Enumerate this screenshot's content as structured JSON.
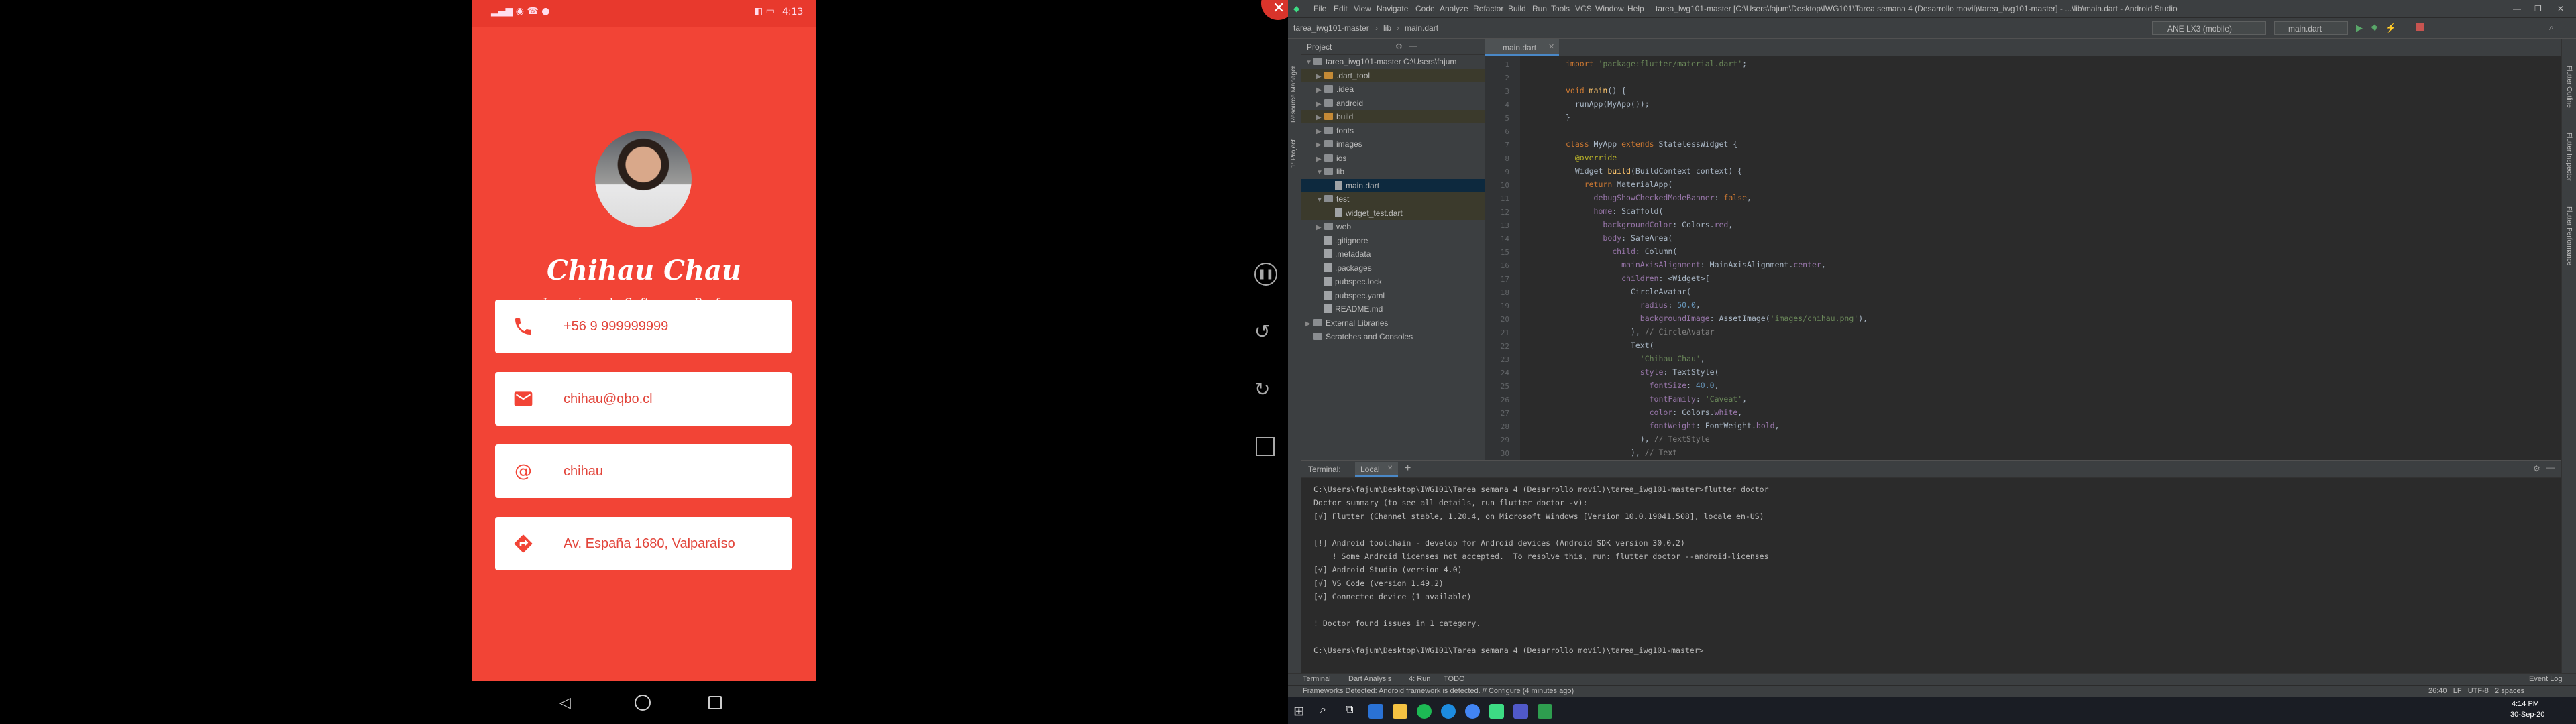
{
  "phone": {
    "status_time": "4:13",
    "name": "Chihau Chau",
    "subtitle": "Ingeniero de Software y Profesor",
    "cards": [
      {
        "icon": "phone-icon",
        "text": "+56 9 999999999"
      },
      {
        "icon": "mail-icon",
        "text": "chihau@qbo.cl"
      },
      {
        "icon": "at-icon",
        "text": "chihau"
      },
      {
        "icon": "directions-icon",
        "text": "Av. España 1680, Valparaíso"
      }
    ]
  },
  "ide": {
    "title": "tarea_lwg101-master [C:\\Users\\fajum\\Desktop\\IWG101\\Tarea semana 4 (Desarrollo movil)\\tarea_iwg101-master] - ...\\lib\\main.dart - Android Studio",
    "menu": [
      "File",
      "Edit",
      "View",
      "Navigate",
      "Code",
      "Analyze",
      "Refactor",
      "Build",
      "Run",
      "Tools",
      "VCS",
      "Window",
      "Help"
    ],
    "breadcrumb": [
      "tarea_iwg101-master",
      "lib",
      "main.dart"
    ],
    "device_select": "ANE LX3 (mobile)",
    "run_config": "main.dart",
    "project_label": "Project",
    "tree": [
      {
        "label": "tarea_iwg101-master  C:\\Users\\fajum",
        "indent": 0,
        "arrow": "▼",
        "kind": "folder"
      },
      {
        "label": ".dart_tool",
        "indent": 1,
        "arrow": "▶",
        "kind": "orange"
      },
      {
        "label": ".idea",
        "indent": 1,
        "arrow": "▶",
        "kind": "folder"
      },
      {
        "label": "android",
        "indent": 1,
        "arrow": "▶",
        "kind": "folder"
      },
      {
        "label": "build",
        "indent": 1,
        "arrow": "▶",
        "kind": "orange"
      },
      {
        "label": "fonts",
        "indent": 1,
        "arrow": "▶",
        "kind": "folder"
      },
      {
        "label": "images",
        "indent": 1,
        "arrow": "▶",
        "kind": "folder"
      },
      {
        "label": "ios",
        "indent": 1,
        "arrow": "▶",
        "kind": "folder"
      },
      {
        "label": "lib",
        "indent": 1,
        "arrow": "▼",
        "kind": "folder"
      },
      {
        "label": "main.dart",
        "indent": 2,
        "arrow": "",
        "kind": "file",
        "selected": true
      },
      {
        "label": "test",
        "indent": 1,
        "arrow": "▼",
        "kind": "folder"
      },
      {
        "label": "widget_test.dart",
        "indent": 2,
        "arrow": "",
        "kind": "file"
      },
      {
        "label": "web",
        "indent": 1,
        "arrow": "▶",
        "kind": "folder"
      },
      {
        "label": ".gitignore",
        "indent": 1,
        "arrow": "",
        "kind": "file"
      },
      {
        "label": ".metadata",
        "indent": 1,
        "arrow": "",
        "kind": "file"
      },
      {
        "label": ".packages",
        "indent": 1,
        "arrow": "",
        "kind": "file"
      },
      {
        "label": "pubspec.lock",
        "indent": 1,
        "arrow": "",
        "kind": "file"
      },
      {
        "label": "pubspec.yaml",
        "indent": 1,
        "arrow": "",
        "kind": "file"
      },
      {
        "label": "README.md",
        "indent": 1,
        "arrow": "",
        "kind": "file"
      },
      {
        "label": "External Libraries",
        "indent": 0,
        "arrow": "▶",
        "kind": "folder"
      },
      {
        "label": "Scratches and Consoles",
        "indent": 0,
        "arrow": "",
        "kind": "folder"
      }
    ],
    "editor_tab": "main.dart",
    "line_numbers": [
      "1",
      "2",
      "3",
      "4",
      "5",
      "6",
      "7",
      "8",
      "9",
      "10",
      "11",
      "12",
      "13",
      "14",
      "15",
      "16",
      "17",
      "18",
      "19",
      "20",
      "21",
      "22",
      "23",
      "24",
      "25",
      "26",
      "27",
      "28",
      "29",
      "30"
    ],
    "terminal_tabs": [
      "Terminal:",
      "Local"
    ],
    "terminal_lines": [
      "C:\\Users\\fajum\\Desktop\\IWG101\\Tarea semana 4 (Desarrollo movil)\\tarea_iwg101-master>flutter doctor",
      "Doctor summary (to see all details, run flutter doctor -v):",
      "[√] Flutter (Channel stable, 1.20.4, on Microsoft Windows [Version 10.0.19041.508], locale en-US)",
      "",
      "[!] Android toolchain - develop for Android devices (Android SDK version 30.0.2)",
      "    ! Some Android licenses not accepted.  To resolve this, run: flutter doctor --android-licenses",
      "[√] Android Studio (version 4.0)",
      "[√] VS Code (version 1.49.2)",
      "[√] Connected device (1 available)",
      "",
      "! Doctor found issues in 1 category.",
      "",
      "C:\\Users\\fajum\\Desktop\\IWG101\\Tarea semana 4 (Desarrollo movil)\\tarea_iwg101-master>"
    ],
    "toolwindows": [
      "Terminal",
      "Dart Analysis",
      "4: Run",
      "TODO"
    ],
    "event_log": "Event Log",
    "status_message": "Frameworks Detected: Android framework is detected. // Configure (4 minutes ago)",
    "status_right": "26:40   LF   UTF-8   2 spaces",
    "clock_time": "4:14 PM",
    "clock_date": "30-Sep-20"
  }
}
